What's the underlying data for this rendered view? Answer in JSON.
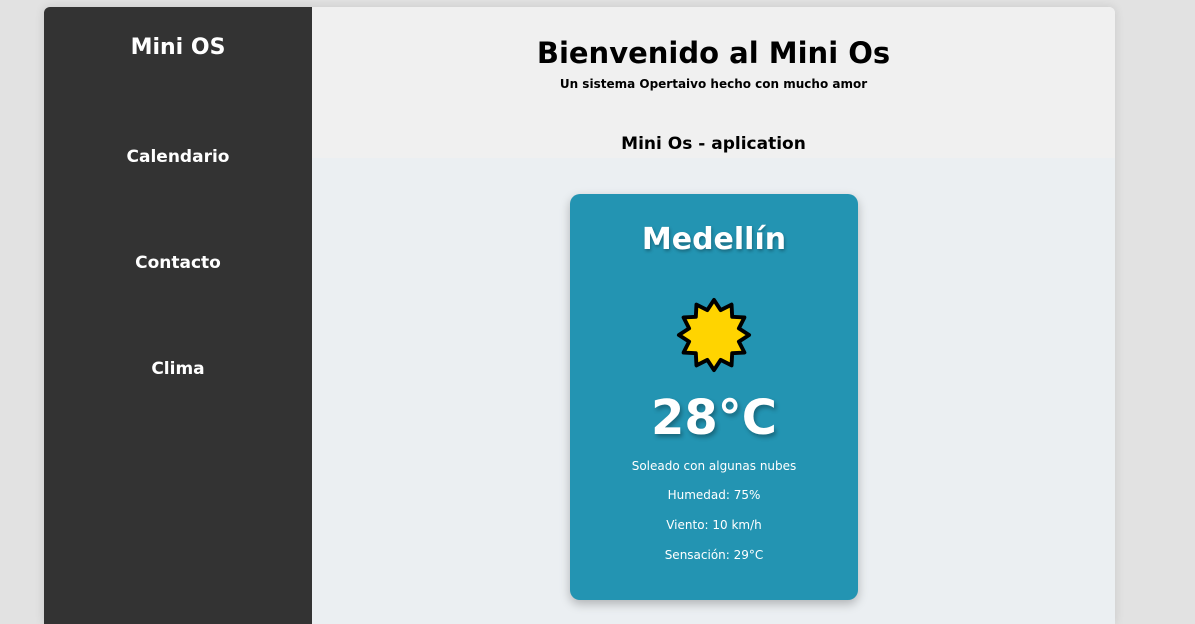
{
  "sidebar": {
    "title": "Mini OS",
    "items": [
      {
        "label": "Calendario"
      },
      {
        "label": "Contacto"
      },
      {
        "label": "Clima"
      }
    ]
  },
  "header": {
    "title": "Bienvenido al Mini Os",
    "subtitle": "Un sistema Opertaivo hecho con mucho amor",
    "app_title": "Mini Os - aplication"
  },
  "weather": {
    "city": "Medellín",
    "icon": "sun-icon",
    "temperature": "28°C",
    "description": "Soleado con algunas nubes",
    "humidity": "Humedad: 75%",
    "wind": "Viento: 10 km/h",
    "feels_like": "Sensación: 29°C",
    "card_color": "#2394b2"
  },
  "colors": {
    "sidebar_bg": "#333333",
    "header_bg": "#f0f0f0",
    "main_bg": "#ebeff2"
  }
}
